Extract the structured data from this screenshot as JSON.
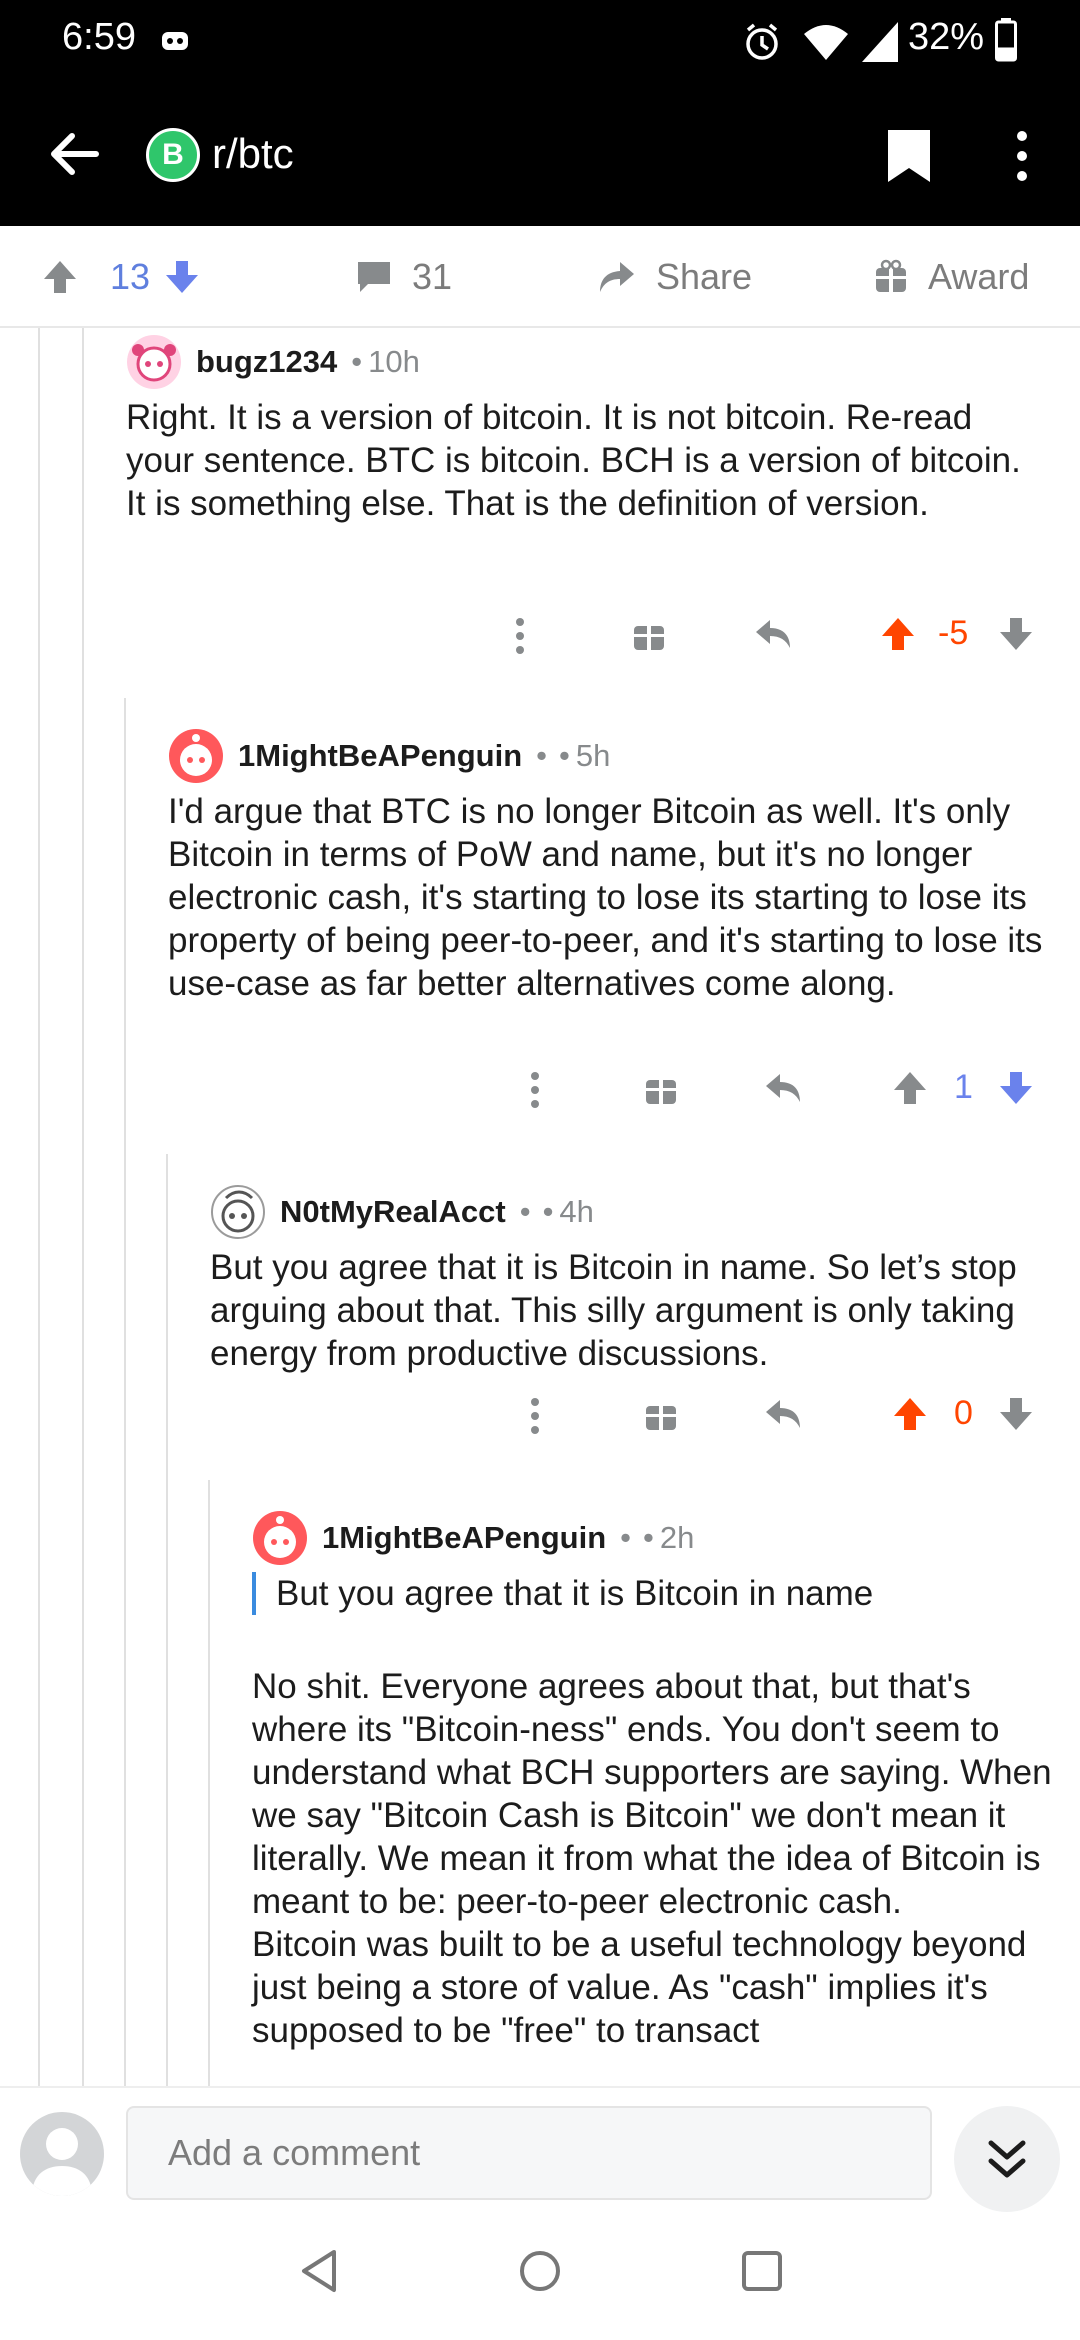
{
  "status_bar": {
    "time": "6:59",
    "battery_percent": "32%",
    "battery_level": 0.32
  },
  "header": {
    "subreddit": "r/btc",
    "subreddit_icon_letter": "B",
    "subreddit_icon_color": "#2fc66b"
  },
  "post_bar": {
    "score": "13",
    "comments": "31",
    "share_label": "Share",
    "award_label": "Award"
  },
  "colors": {
    "upvote_active": "#ff4500",
    "downvote_active": "#6a82ec",
    "neutral_icon": "#878a8c",
    "quote_bar": "#3a8bdf"
  },
  "comments": [
    {
      "author": "bugz1234",
      "age": "10h",
      "paragraphs": [
        "Right. It is a version of bitcoin. It is not bitcoin. Re-read your sentence.  BTC is bitcoin. BCH is a version of bitcoin. It is something else. That is the definition of version."
      ],
      "score": "-5",
      "vote_state": "up"
    },
    {
      "author": "1MightBeAPenguin",
      "age": "5h",
      "paragraphs": [
        "I'd argue that BTC is no longer Bitcoin as well. It's only Bitcoin in terms of PoW and name, but it's no longer electronic cash, it's starting to lose its starting to lose its property of being peer-to-peer, and it's starting to lose its use-case as far better alternatives come along."
      ],
      "score": "1",
      "vote_state": "down"
    },
    {
      "author": "N0tMyRealAcct",
      "age": "4h",
      "paragraphs": [
        "But you agree that it is Bitcoin in name. So let’s stop arguing about that. This silly argument is only taking energy from productive discussions."
      ],
      "score": "0",
      "vote_state": "up"
    },
    {
      "author": "1MightBeAPenguin",
      "age": "2h",
      "quote": "But you agree that it is Bitcoin in name",
      "paragraphs": [
        "No shit. Everyone agrees about that, but that's where its \"Bitcoin-ness\" ends. You don't seem to understand what BCH supporters are saying. When we say \"Bitcoin Cash is Bitcoin\" we don't mean it literally. We mean it from what the idea of Bitcoin is meant to be: peer-to-peer electronic cash.",
        "Bitcoin was built to be a useful technology beyond just being a store of value. As \"cash\" implies it's supposed to be \"free\" to transact"
      ]
    }
  ],
  "comment_bar": {
    "placeholder": "Add a comment"
  }
}
